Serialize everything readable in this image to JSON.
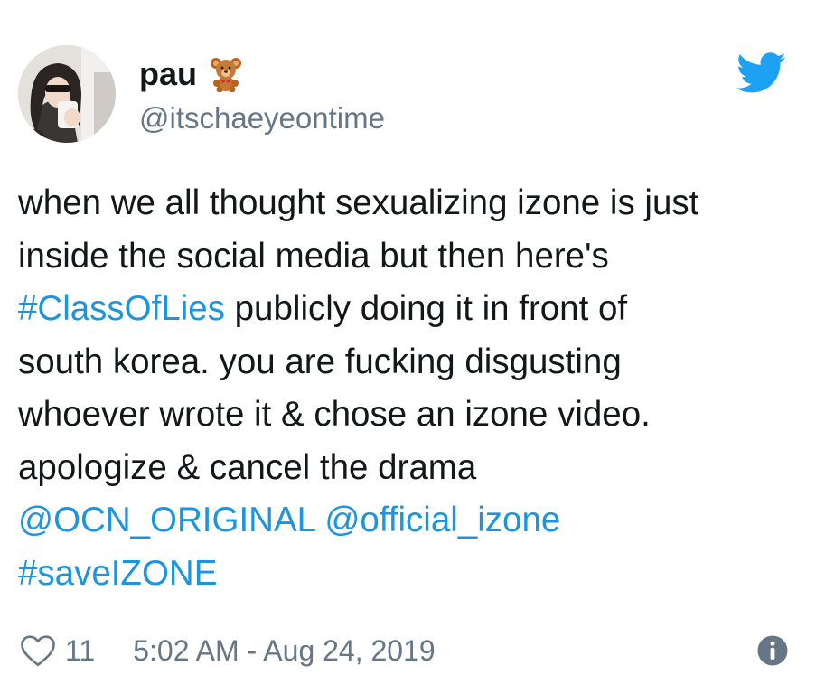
{
  "user": {
    "display_name": "pau",
    "name_emoji": "teddy-bear-emoji",
    "handle": "@itschaeyeontime"
  },
  "tweet": {
    "lines": [
      [
        {
          "text": "when we all thought sexualizing izone is just",
          "link": false
        }
      ],
      [
        {
          "text": "inside the social media but then here's",
          "link": false
        }
      ],
      [
        {
          "text": "#ClassOfLies",
          "link": true
        },
        {
          "text": " publicly doing it in front of",
          "link": false
        }
      ],
      [
        {
          "text": "south korea. you are fucking disgusting",
          "link": false
        }
      ],
      [
        {
          "text": "whoever wrote it & chose an izone video.",
          "link": false
        }
      ],
      [
        {
          "text": "apologize & cancel the drama",
          "link": false
        }
      ],
      [
        {
          "text": "@OCN_ORIGINAL",
          "link": true
        },
        {
          "text": " ",
          "link": false
        },
        {
          "text": "@official_izone",
          "link": true
        }
      ],
      [
        {
          "text": "#saveIZONE",
          "link": true
        }
      ]
    ]
  },
  "footer": {
    "like_count": "11",
    "timestamp": "5:02 AM - Aug 24, 2019"
  },
  "icons": {
    "logo": "twitter-bird-icon",
    "like": "heart-icon",
    "info": "info-icon"
  },
  "colors": {
    "link": "#1b95e0",
    "twitter_blue": "#1da1f2",
    "secondary_text": "#657786",
    "primary_text": "#14171a"
  }
}
